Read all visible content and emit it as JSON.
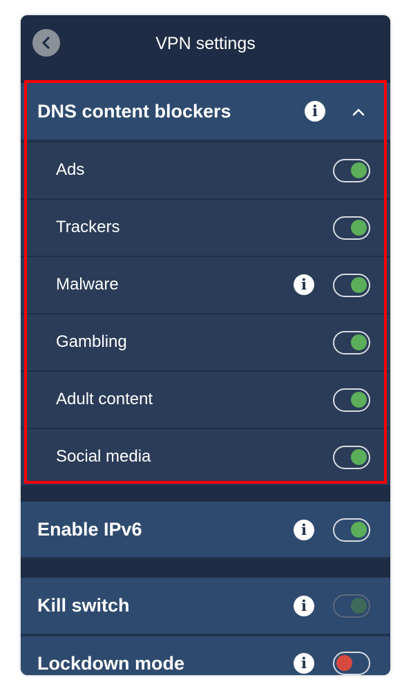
{
  "header": {
    "title": "VPN settings",
    "back_icon": "chevron-left-icon"
  },
  "dns": {
    "title": "DNS content blockers",
    "expanded": true,
    "items": [
      {
        "label": "Ads",
        "on": true,
        "info": false
      },
      {
        "label": "Trackers",
        "on": true,
        "info": false
      },
      {
        "label": "Malware",
        "on": true,
        "info": true
      },
      {
        "label": "Gambling",
        "on": true,
        "info": false
      },
      {
        "label": "Adult content",
        "on": true,
        "info": false
      },
      {
        "label": "Social media",
        "on": true,
        "info": false
      }
    ]
  },
  "ipv6": {
    "label": "Enable IPv6",
    "on": true
  },
  "kill_switch": {
    "label": "Kill switch",
    "on": true,
    "disabled": true
  },
  "lockdown": {
    "label": "Lockdown mode",
    "on": false
  },
  "info_glyph": "i",
  "colors": {
    "toggle_on": "#5cae5a",
    "toggle_off": "#d84a3f",
    "highlight": "#ff0000",
    "background": "#1e2d45"
  }
}
